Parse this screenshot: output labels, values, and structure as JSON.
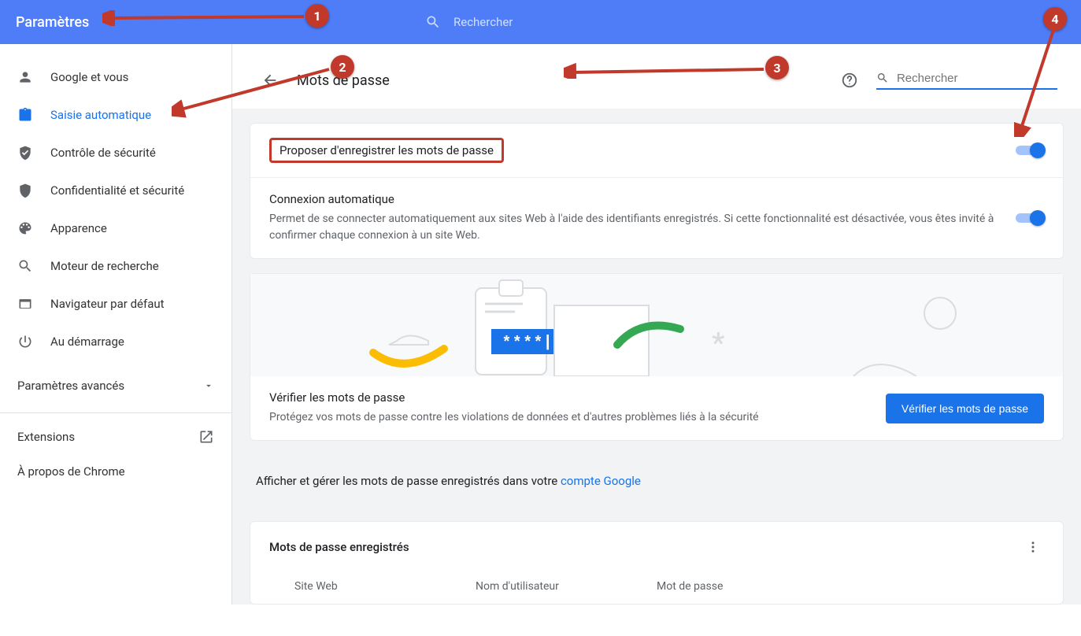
{
  "header": {
    "title": "Paramètres",
    "search_placeholder": "Rechercher"
  },
  "sidebar": {
    "items": [
      {
        "label": "Google et vous"
      },
      {
        "label": "Saisie automatique"
      },
      {
        "label": "Contrôle de sécurité"
      },
      {
        "label": "Confidentialité et sécurité"
      },
      {
        "label": "Apparence"
      },
      {
        "label": "Moteur de recherche"
      },
      {
        "label": "Navigateur par défaut"
      },
      {
        "label": "Au démarrage"
      }
    ],
    "advanced_label": "Paramètres avancés",
    "extensions_label": "Extensions",
    "about_label": "À propos de Chrome"
  },
  "page": {
    "title": "Mots de passe",
    "search_placeholder": "Rechercher"
  },
  "settings": {
    "offer_save_label": "Proposer d'enregistrer les mots de passe",
    "auto_signin_title": "Connexion automatique",
    "auto_signin_desc": "Permet de se connecter automatiquement aux sites Web à l'aide des identifiants enregistrés. Si cette fonctionnalité est désactivée, vous êtes invité à confirmer chaque connexion à un site Web."
  },
  "verify": {
    "title": "Vérifier les mots de passe",
    "desc": "Protégez vos mots de passe contre les violations de données et d'autres problèmes liés à la sécurité",
    "button": "Vérifier les mots de passe"
  },
  "manage": {
    "prefix": "Afficher et gérer les mots de passe enregistrés dans votre ",
    "link": "compte Google"
  },
  "saved": {
    "heading": "Mots de passe enregistrés",
    "col_site": "Site Web",
    "col_user": "Nom d'utilisateur",
    "col_pass": "Mot de passe"
  },
  "illus": {
    "mask": "* * * * |"
  },
  "annotations": {
    "1": "1",
    "2": "2",
    "3": "3",
    "4": "4"
  }
}
